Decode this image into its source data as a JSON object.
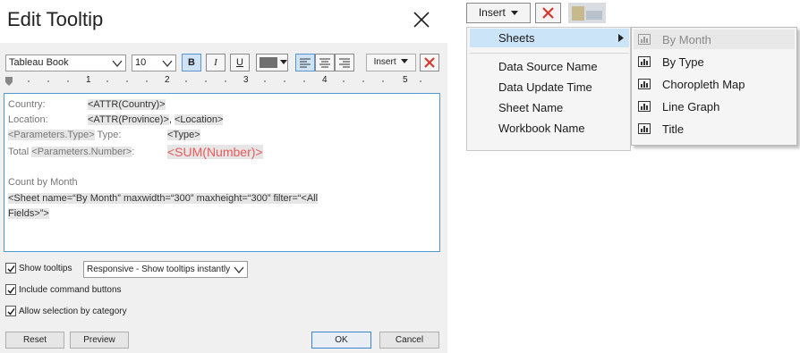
{
  "dialog": {
    "title": "Edit Tooltip",
    "toolbar": {
      "font_family": "Tableau Book",
      "font_size": "10",
      "bold_label": "B",
      "italic_label": "I",
      "underline_label": "U",
      "insert_label": "Insert",
      "text_color": "#707070"
    },
    "ruler_ticks": [
      "1",
      "2",
      "3",
      "4",
      "5"
    ],
    "editor": {
      "line1_label": "Country:",
      "line1_value": "<ATTR(Country)>",
      "line2_label": "Location:",
      "line2_value_a": "<ATTR(Province)>",
      "line2_sep": ", ",
      "line2_value_b": "<Location>",
      "line3_param": "<Parameters.Type>",
      "line3_label": " Type:",
      "line3_value": "<Type>",
      "line4_label": "Total ",
      "line4_param": "<Parameters.Number>",
      "line4_colon": ":",
      "line4_value": "<SUM(Number)>",
      "line5": "Count by Month",
      "line6": "<Sheet name=“By Month” maxwidth=“300” maxheight=“300” filter=“<All",
      "line7": "Fields>”>"
    },
    "options": {
      "show_tooltips_label": "Show tooltips",
      "show_tooltips_checked": true,
      "tooltip_mode": "Responsive - Show tooltips instantly",
      "include_command_label": "Include command buttons",
      "include_command_checked": true,
      "allow_selection_label": "Allow selection by category",
      "allow_selection_checked": true
    },
    "buttons": {
      "reset": "Reset",
      "preview": "Preview",
      "ok": "OK",
      "cancel": "Cancel"
    }
  },
  "insert_menu": {
    "button_label": "Insert",
    "items": [
      "Sheets",
      "Data Source Name",
      "Data Update Time",
      "Sheet Name",
      "Workbook Name"
    ],
    "sheets_submenu": [
      "By Month",
      "By Type",
      "Choropleth Map",
      "Line Graph",
      "Title"
    ]
  },
  "colors": {
    "accent": "#4d9ad6",
    "highlight": "#cce4f7",
    "red": "#e85a5a",
    "dialog_bg": "#f0f0f0"
  },
  "icons": {
    "close": "close-icon",
    "delete": "red-x-icon",
    "sheet": "bar-chart-icon",
    "submenu": "triangle-right-icon"
  }
}
